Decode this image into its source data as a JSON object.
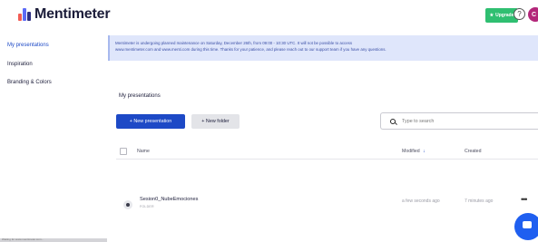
{
  "app": {
    "logo_text": "Mentimeter",
    "logo_colors": [
      "#f25c54",
      "#5d6bf7",
      "#2d2e83"
    ]
  },
  "header": {
    "upgrade_label": "Upgrade",
    "upgrade_icon": "star-icon",
    "help_icon": "question-circle-icon",
    "avatar_initial": "C",
    "accent_green": "#2fbf71",
    "avatar_color": "#b3277a"
  },
  "sidebar": {
    "items": [
      {
        "label": "My presentations",
        "active": true
      },
      {
        "label": "Inspiration",
        "active": false
      },
      {
        "label": "Branding & Colors",
        "active": false
      }
    ],
    "footer_text": "Waiting for www.mentimeter.com..."
  },
  "banner": {
    "line1": "Mentimeter is undergoing planned maintenance on Saturday, December 26th, from 09:00 - 10:30 UTC. It will not be possible to access",
    "line2": "www.mentimeter.com and www.menti.com during this time. Thanks for your patience, and please reach out to our support team if you have any questions."
  },
  "main": {
    "section_title": "My presentations",
    "new_presentation_label": "+ New presentation",
    "new_folder_label": "+ New folder",
    "search_placeholder": "Type to search",
    "primary_color": "#1d49c6"
  },
  "table": {
    "columns": {
      "name": "Name",
      "modified": "Modified",
      "modified_sort_icon": "arrow-down-icon",
      "created": "Created"
    },
    "rows": [
      {
        "name": "Sesion0_NubeEmociones",
        "subtitle": "FOLDER",
        "modified": "a few seconds ago",
        "created": "7 minutes ago",
        "more_label": "•••"
      }
    ]
  },
  "chat_icon": "chat-bubble-icon"
}
